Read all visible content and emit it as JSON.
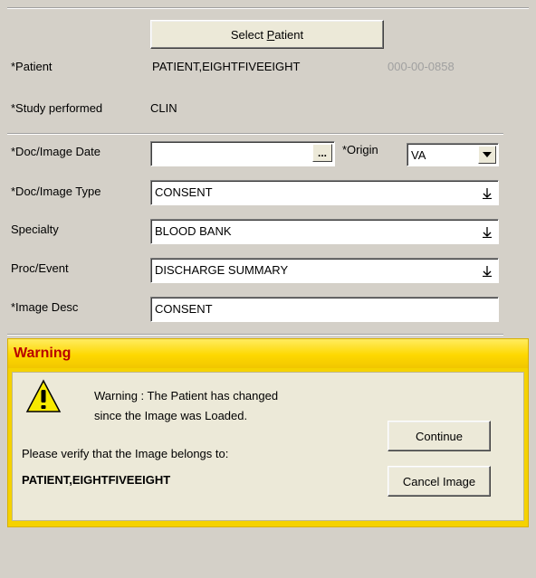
{
  "buttons": {
    "select_patient": "Select Patient",
    "continue": "Continue",
    "cancel_image": "Cancel Image",
    "ellipsis": "..."
  },
  "patient": {
    "label": "*Patient",
    "name": "PATIENT,EIGHTFIVEEIGHT",
    "ssn": "000-00-0858"
  },
  "study": {
    "label": "*Study performed",
    "value": "CLIN"
  },
  "doc_date": {
    "label": "*Doc/Image Date",
    "value": ""
  },
  "origin": {
    "label": "*Origin",
    "value": "VA"
  },
  "doc_type": {
    "label": "*Doc/Image Type",
    "value": "CONSENT"
  },
  "specialty": {
    "label": "Specialty",
    "value": "BLOOD BANK"
  },
  "proc_event": {
    "label": "Proc/Event",
    "value": "DISCHARGE SUMMARY"
  },
  "image_desc": {
    "label": "*Image Desc",
    "value": "CONSENT"
  },
  "warning": {
    "title": "Warning",
    "line1": "Warning : The Patient has changed",
    "line2": "since the Image was Loaded.",
    "verify": "Please verify that the Image belongs to:",
    "patient": "PATIENT,EIGHTFIVEEIGHT"
  },
  "colors": {
    "warning_title": "#b80000",
    "warning_bar": "#fed800",
    "ssn_text": "#a0a0a0"
  }
}
